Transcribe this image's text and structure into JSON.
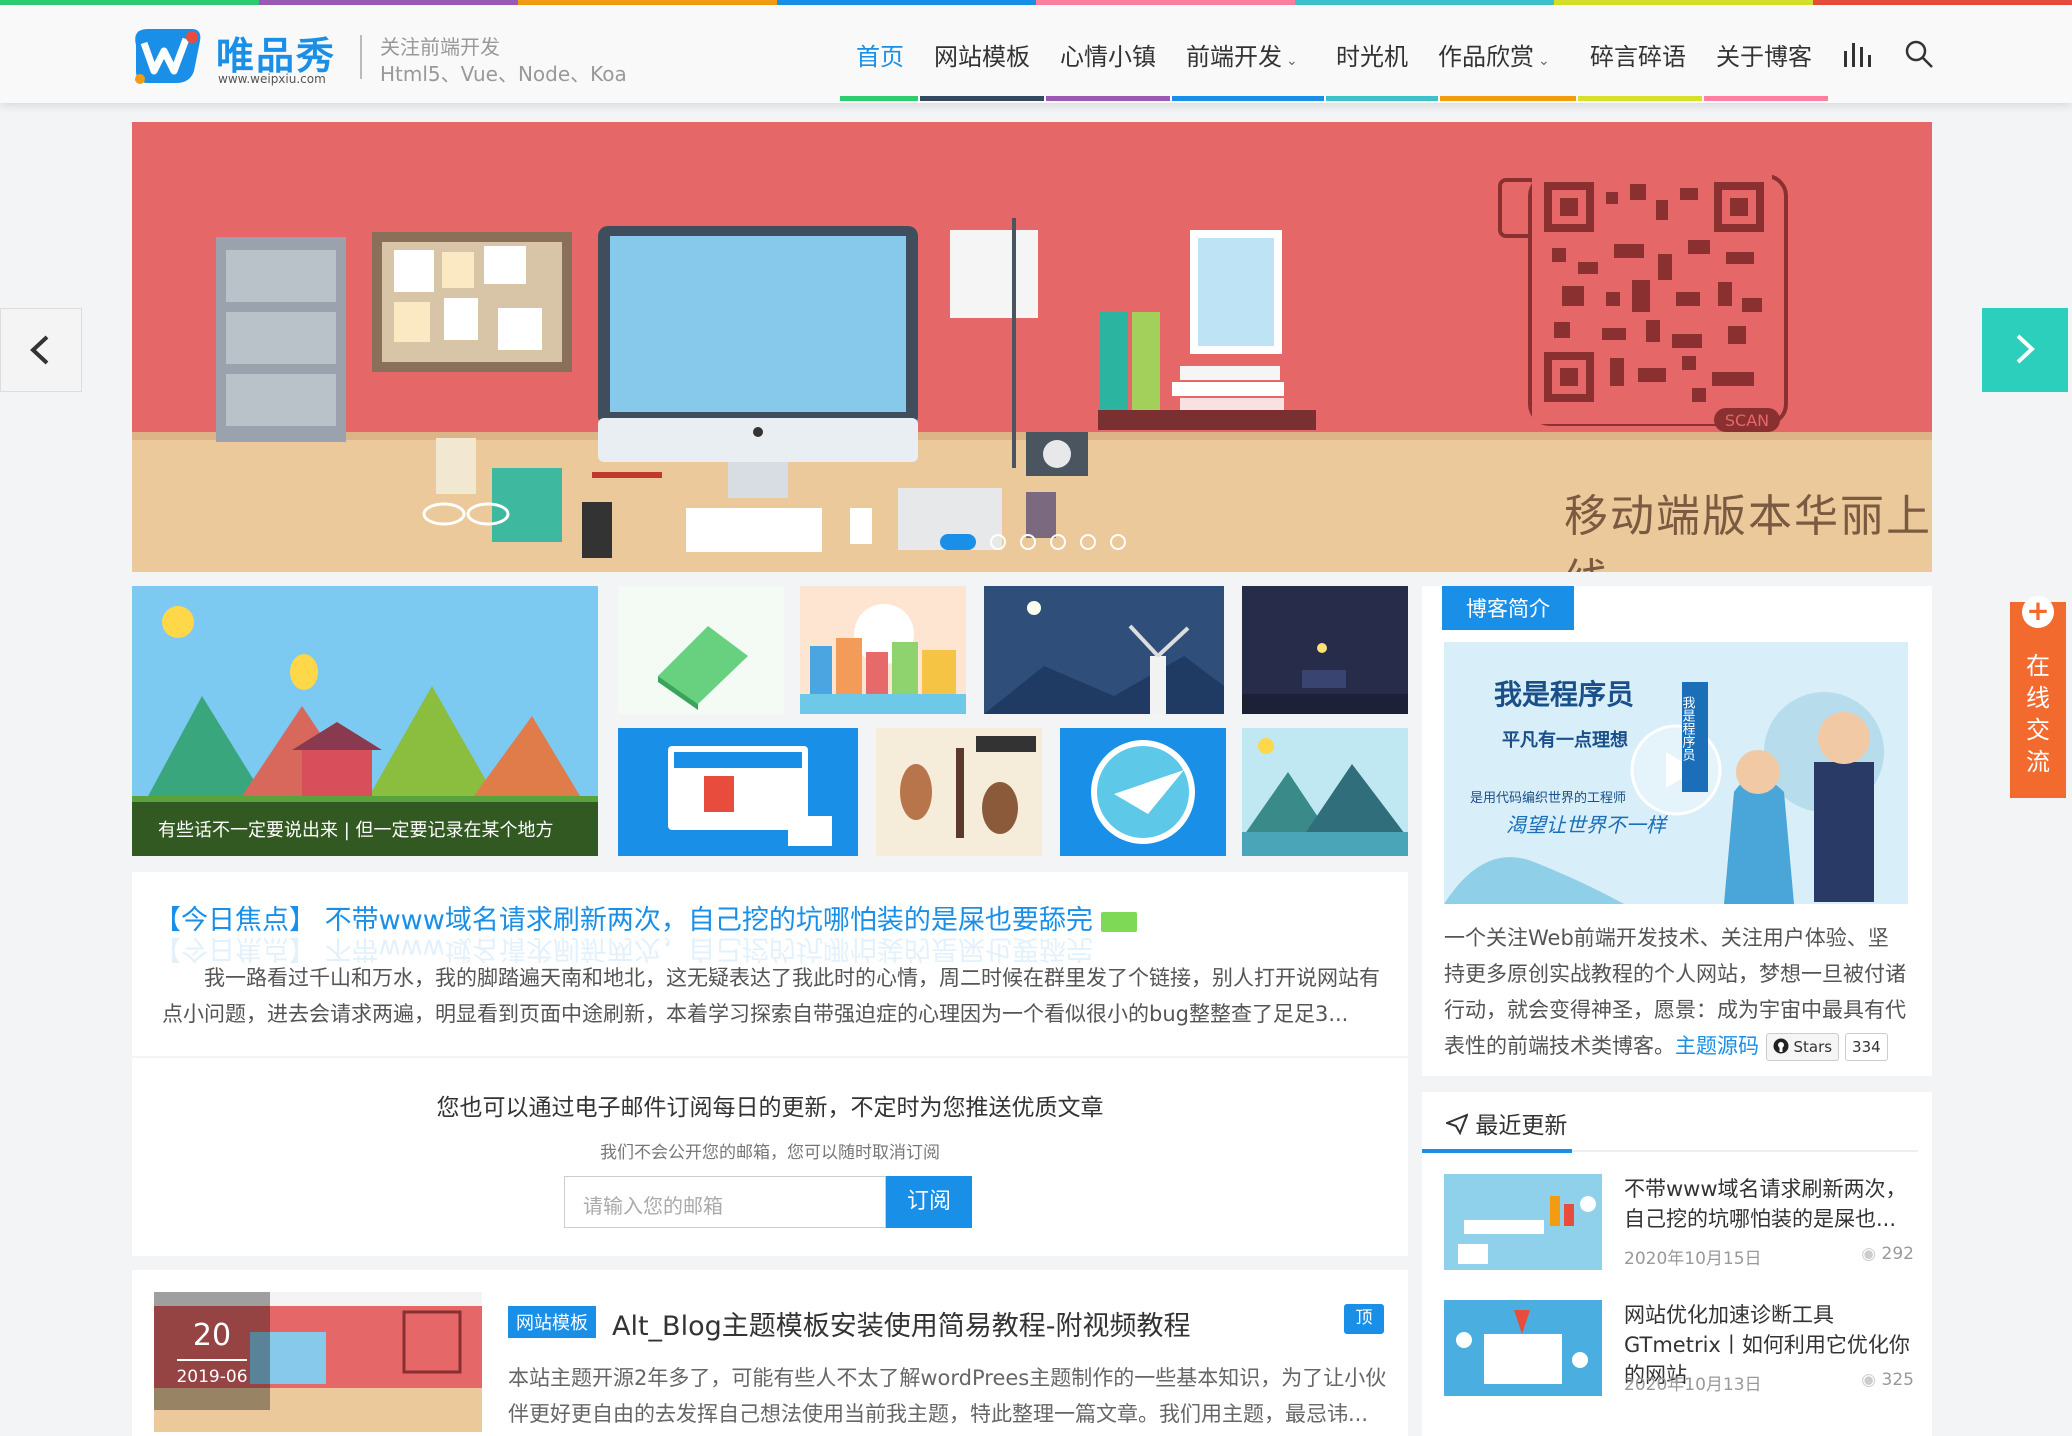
{
  "header": {
    "logo_title": "唯品秀",
    "logo_url": "www.weipxiu.com",
    "tagline1": "关注前端开发",
    "tagline2": "Html5、Vue、Node、Koa"
  },
  "nav": [
    {
      "label": "首页",
      "active": true,
      "color": "#2ecc71"
    },
    {
      "label": "网站模板",
      "color": "#34495e"
    },
    {
      "label": "心情小镇",
      "color": "#9b59b6"
    },
    {
      "label": "前端开发",
      "dropdown": true,
      "color": "#1a8fe8"
    },
    {
      "label": "时光机",
      "color": "#3fc1c9"
    },
    {
      "label": "作品欣赏",
      "dropdown": true,
      "color": "#f39c12"
    },
    {
      "label": "碎言碎语",
      "color": "#d6e02c"
    },
    {
      "label": "关于博客",
      "color": "#ff7fa0"
    }
  ],
  "banner": {
    "text": "移动端版本华丽上线",
    "scan": "SCAN",
    "slide_count": 6,
    "active_slide": 0
  },
  "featured": {
    "caption": "有些话不一定要说出来 | 但一定要记录在某个地方"
  },
  "focus": {
    "title": "【今日焦点】 不带www域名请求刷新两次，自己挖的坑哪怕装的是屎也要舔完",
    "body": "我一路看过千山和万水，我的脚踏遍天南和地北，这无疑表达了我此时的心情，周二时候在群里发了个链接，别人打开说网站有点小问题，进去会请求两遍，明显看到页面中途刷新，本着学习探索自带强迫症的心理因为一个看似很小的bug整整查了足足3..."
  },
  "subscribe": {
    "title": "您也可以通过电子邮件订阅每日的更新，不定时为您推送优质文章",
    "note": "我们不会公开您的邮箱，您可以随时取消订阅",
    "placeholder": "请输入您的邮箱",
    "button": "订阅"
  },
  "post": {
    "day": "20",
    "ym": "2019-06",
    "category": "网站模板",
    "title": "Alt_Blog主题模板安装使用简易教程-附视频教程",
    "badge": "顶",
    "body": "本站主题开源2年多了，可能有些人不太了解wordPrees主题制作的一些基本知识，为了让小伙伴更好更自由的去发挥自己想法使用当前我主题，特此整理一篇文章。我们用主题，最忌讳..."
  },
  "sidebar": {
    "intro_tag": "博客简介",
    "intro_img_title": "我是程序员",
    "intro_img_sub": "平凡有一点理想",
    "intro_img_line": "是用代码编织世界的工程师",
    "intro_img_slogan": "渴望让世界不一样",
    "intro_img_vert": "我是程序员",
    "intro_text": "一个关注Web前端开发技术、关注用户体验、坚持更多原创实战教程的个人网站，梦想一旦被付诸行动，就会变得神圣，愿景：成为宇宙中最具有代表性的前端技术类博客。",
    "theme_link": "主题源码",
    "stars_label": "Stars",
    "stars_count": "334",
    "recent_head": "最近更新",
    "recent": [
      {
        "title": "不带www域名请求刷新两次，自己挖的坑哪怕装的是屎也...",
        "date": "2020年10月15日",
        "views": "292"
      },
      {
        "title": "网站优化加速诊断工具GTmetrix丨如何利用它优化你的网站",
        "date": "2020年10月13日",
        "views": "325"
      }
    ]
  },
  "float_tab": {
    "label": "在线交流"
  },
  "colors": {
    "accent": "#1a8fe8",
    "banner_bg": "#e66767",
    "float": "#f36a2f",
    "arrow_right": "#2bcfbc"
  }
}
